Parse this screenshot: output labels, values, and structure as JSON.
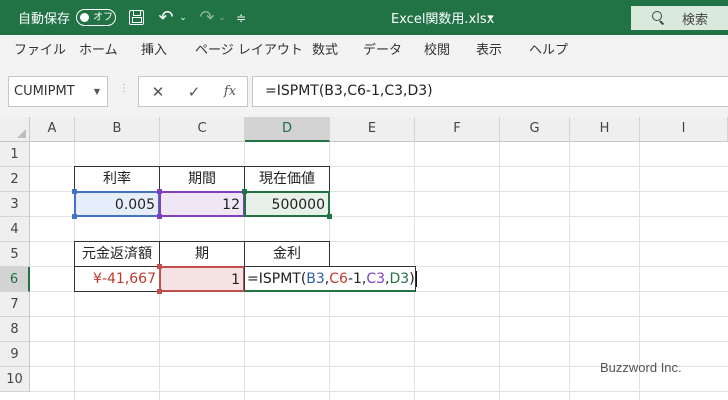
{
  "titlebar": {
    "autosave_label": "自動保存",
    "autosave_state": "オフ",
    "document_title": "Excel関数用.xlsx",
    "search_label": "検索"
  },
  "ribbon": {
    "tabs": [
      "ファイル",
      "ホーム",
      "挿入",
      "ページ レイアウト",
      "数式",
      "データ",
      "校閲",
      "表示",
      "ヘルプ"
    ]
  },
  "formula_bar": {
    "name_box": "CUMIPMT",
    "fx_label": "fx",
    "formula": "=ISPMT(B3,C6-1,C3,D3)"
  },
  "grid": {
    "columns": [
      "A",
      "B",
      "C",
      "D",
      "E",
      "F",
      "G",
      "H",
      "I"
    ],
    "active_column": "D",
    "rows": [
      "1",
      "2",
      "3",
      "4",
      "5",
      "6",
      "7",
      "8",
      "9",
      "10"
    ],
    "active_row": "6"
  },
  "cells": {
    "B2": "利率",
    "C2": "期間",
    "D2": "現在価値",
    "B3": "0.005",
    "C3": "12",
    "D3": "500000",
    "B5": "元金返済額",
    "C5": "期",
    "D5": "金利",
    "B6": "¥-41,667",
    "C6": "1"
  },
  "editing_formula": {
    "prefix": "=ISPMT(",
    "ref1": "B3",
    "sep1": ",",
    "ref2": "C6",
    "mid": "-1,",
    "ref3": "C3",
    "sep2": ",",
    "ref4": "D3",
    "suffix": ")"
  },
  "watermark": "Buzzword Inc.",
  "colors": {
    "excel_green": "#217346",
    "ref_blue": "#4472c4",
    "ref_purple": "#7f3fbf",
    "ref_red": "#c0504d",
    "negative_currency": "#c0392b"
  }
}
